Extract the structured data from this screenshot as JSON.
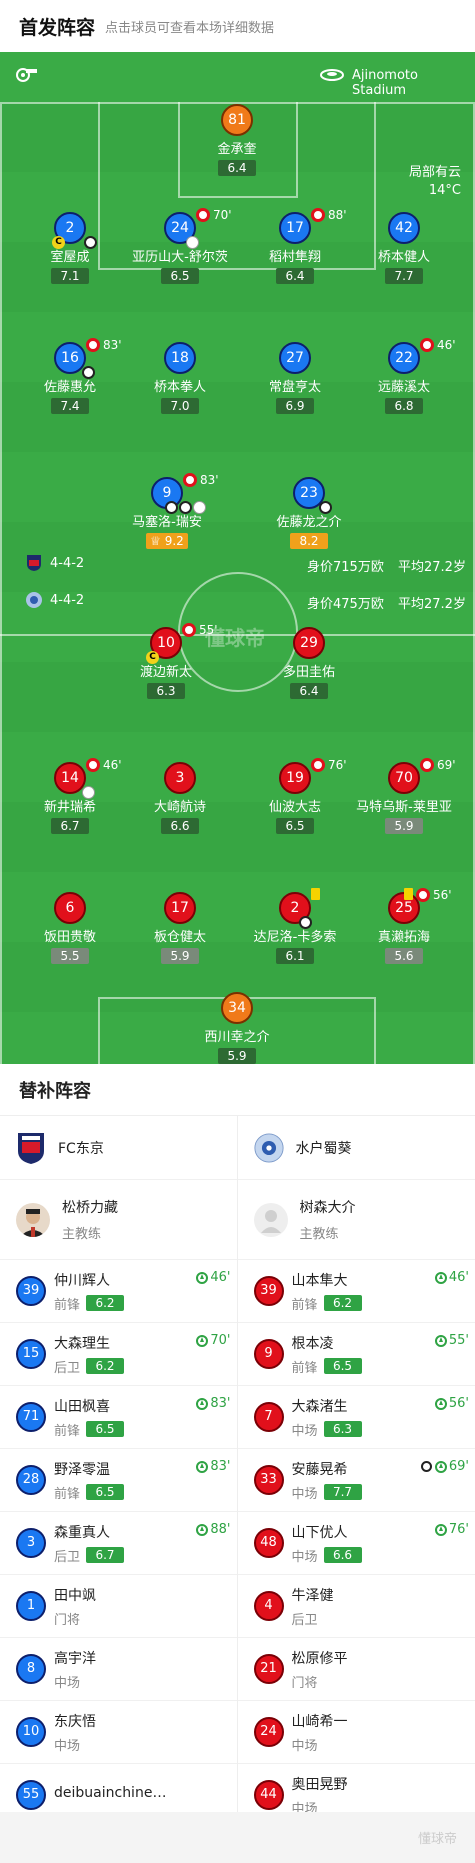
{
  "header": {
    "title": "首发阵容",
    "hint": "点击球员可查看本场详细数据"
  },
  "pitch": {
    "stadium": "Ajinomoto Stadium",
    "weather": "局部有云",
    "temperature": "14°C",
    "watermark": "懂球帝"
  },
  "home": {
    "formation": "4-4-2",
    "value": "身价715万欧",
    "avg_age": "平均27.2岁",
    "players": [
      {
        "num": "81",
        "name": "金承奎",
        "rating": "6.4"
      },
      {
        "num": "2",
        "name": "室屋成",
        "rating": "7.1"
      },
      {
        "num": "24",
        "name": "亚历山大-舒尔茨",
        "rating": "6.5",
        "sub_min": "70'"
      },
      {
        "num": "17",
        "name": "稻村隼翔",
        "rating": "6.4",
        "sub_min": "88'"
      },
      {
        "num": "42",
        "name": "桥本健人",
        "rating": "7.7"
      },
      {
        "num": "16",
        "name": "佐藤惠允",
        "rating": "7.4",
        "sub_min": "83'"
      },
      {
        "num": "18",
        "name": "桥本拳人",
        "rating": "7.0"
      },
      {
        "num": "27",
        "name": "常盘亨太",
        "rating": "6.9"
      },
      {
        "num": "22",
        "name": "远藤溪太",
        "rating": "6.8",
        "sub_min": "46'"
      },
      {
        "num": "9",
        "name": "马塞洛-瑞安",
        "rating": "9.2",
        "sub_min": "83'"
      },
      {
        "num": "23",
        "name": "佐藤龙之介",
        "rating": "8.2"
      }
    ]
  },
  "away": {
    "formation": "4-4-2",
    "value": "身价475万欧",
    "avg_age": "平均27.2岁",
    "players": [
      {
        "num": "10",
        "name": "渡边新太",
        "rating": "6.3",
        "sub_min": "55'"
      },
      {
        "num": "29",
        "name": "多田圭佑",
        "rating": "6.4"
      },
      {
        "num": "14",
        "name": "新井瑞希",
        "rating": "6.7",
        "sub_min": "46'"
      },
      {
        "num": "3",
        "name": "大崎航诗",
        "rating": "6.6"
      },
      {
        "num": "19",
        "name": "仙波大志",
        "rating": "6.5",
        "sub_min": "76'"
      },
      {
        "num": "70",
        "name": "马特乌斯-莱里亚",
        "rating": "5.9",
        "sub_min": "69'"
      },
      {
        "num": "6",
        "name": "饭田贵敬",
        "rating": "5.5"
      },
      {
        "num": "17",
        "name": "板仓健太",
        "rating": "5.9"
      },
      {
        "num": "2",
        "name": "达尼洛-卡多索",
        "rating": "6.1"
      },
      {
        "num": "25",
        "name": "真濑拓海",
        "rating": "5.6",
        "sub_min": "56'"
      },
      {
        "num": "34",
        "name": "西川幸之介",
        "rating": "5.9"
      }
    ]
  },
  "subs": {
    "title": "替补阵容",
    "home": {
      "team": "FC东京",
      "coach": "松桥力藏",
      "coach_role": "主教练",
      "players": [
        {
          "num": "39",
          "name": "仲川辉人",
          "pos": "前锋",
          "rating": "6.2",
          "in": "46'"
        },
        {
          "num": "15",
          "name": "大森理生",
          "pos": "后卫",
          "rating": "6.2",
          "in": "70'"
        },
        {
          "num": "71",
          "name": "山田枫喜",
          "pos": "前锋",
          "rating": "6.5",
          "in": "83'"
        },
        {
          "num": "28",
          "name": "野泽零温",
          "pos": "前锋",
          "rating": "6.5",
          "in": "83'"
        },
        {
          "num": "3",
          "name": "森重真人",
          "pos": "后卫",
          "rating": "6.7",
          "in": "88'"
        },
        {
          "num": "1",
          "name": "田中飒",
          "pos": "门将"
        },
        {
          "num": "8",
          "name": "高宇洋",
          "pos": "中场"
        },
        {
          "num": "10",
          "name": "东庆悟",
          "pos": "中场"
        },
        {
          "num": "55",
          "name": "deibuainchine…",
          "pos": ""
        }
      ]
    },
    "away": {
      "team": "水户蜀葵",
      "coach": "树森大介",
      "coach_role": "主教练",
      "players": [
        {
          "num": "39",
          "name": "山本隼大",
          "pos": "前锋",
          "rating": "6.2",
          "in": "46'"
        },
        {
          "num": "9",
          "name": "根本凌",
          "pos": "前锋",
          "rating": "6.5",
          "in": "55'"
        },
        {
          "num": "7",
          "name": "大森渚生",
          "pos": "中场",
          "rating": "6.3",
          "in": "56'"
        },
        {
          "num": "33",
          "name": "安藤晃希",
          "pos": "中场",
          "rating": "7.7",
          "in": "69'"
        },
        {
          "num": "48",
          "name": "山下优人",
          "pos": "中场",
          "rating": "6.6",
          "in": "76'"
        },
        {
          "num": "4",
          "name": "牛泽健",
          "pos": "后卫"
        },
        {
          "num": "21",
          "name": "松原修平",
          "pos": "门将"
        },
        {
          "num": "24",
          "name": "山崎希一",
          "pos": "中场"
        },
        {
          "num": "44",
          "name": "奥田晃野",
          "pos": "中场"
        }
      ]
    }
  },
  "footer": {
    "watermark": "懂球帝"
  },
  "colors": {
    "pitch": "#3aab46",
    "home": "#1a78f2",
    "away": "#e1101b",
    "gk": "#f07a1a",
    "rating": "#2fa344"
  },
  "icons": [
    "whistle-icon",
    "stadium-icon",
    "sub-off-icon",
    "sub-on-icon",
    "goal-ball-icon",
    "assist-boot-icon",
    "captain-icon",
    "yellow-card-icon",
    "team-crest-icon",
    "coach-avatar-icon"
  ]
}
